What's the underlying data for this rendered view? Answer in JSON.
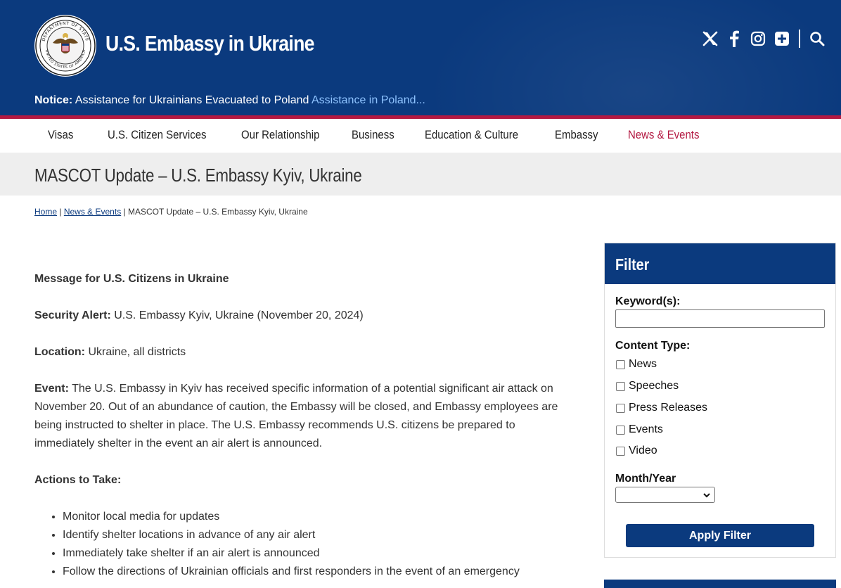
{
  "header": {
    "site_title": "U.S. Embassy in Ukraine",
    "seal_text_top": "DEPARTMENT OF STATE",
    "seal_text_bottom": "UNITED STATES OF AMERICA",
    "social_icons": [
      "x-icon",
      "facebook-icon",
      "instagram-icon",
      "flickr-plus-icon",
      "search-icon"
    ],
    "notice_label": "Notice:",
    "notice_text": "Assistance for Ukrainians Evacuated to Poland",
    "notice_link": "Assistance in Poland..."
  },
  "nav": {
    "items": [
      "Visas",
      "U.S. Citizen Services",
      "Our Relationship",
      "Business",
      "Education & Culture",
      "Embassy",
      "News & Events"
    ],
    "active": "News & Events"
  },
  "page": {
    "title": "MASCOT Update – U.S. Embassy Kyiv, Ukraine"
  },
  "breadcrumb": {
    "home": "Home",
    "section": "News & Events",
    "current": "MASCOT Update – U.S. Embassy Kyiv, Ukraine",
    "separator": "|"
  },
  "article": {
    "heading": "Message for U.S. Citizens in Ukraine",
    "security_label": "Security Alert:",
    "security_text": "U.S. Embassy Kyiv, Ukraine (November 20, 2024)",
    "location_label": "Location:",
    "location_text": "Ukraine, all districts",
    "event_label": "Event:",
    "event_text": "The U.S. Embassy in Kyiv has received specific information of a potential significant air attack on November 20.  Out of an abundance of caution, the Embassy will be closed, and Embassy employees are being instructed to shelter in place.  The U.S. Embassy recommends U.S. citizens be prepared to immediately shelter in the event an air alert is announced.",
    "actions_label": "Actions to Take:",
    "actions": [
      "Monitor local media for updates",
      "Identify shelter locations in advance of any air alert",
      "Immediately take shelter if an air alert is announced",
      "Follow the directions of Ukrainian officials and first responders in the event of an emergency"
    ]
  },
  "filter": {
    "title": "Filter",
    "keyword_label": "Keyword(s):",
    "keyword_value": "",
    "content_type_label": "Content Type:",
    "content_types": [
      "News",
      "Speeches",
      "Press Releases",
      "Events",
      "Video"
    ],
    "month_year_label": "Month/Year",
    "month_year_value": "",
    "apply_label": "Apply Filter"
  },
  "colors": {
    "brand_blue": "#0b3a7e",
    "accent_red": "#b31942",
    "notice_link": "#8ec3ff"
  }
}
